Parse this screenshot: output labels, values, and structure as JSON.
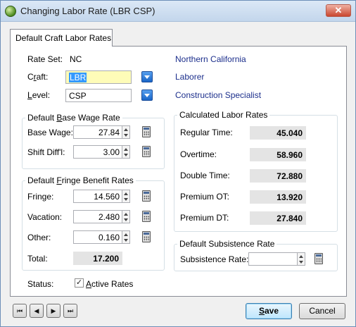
{
  "window": {
    "title": "Changing Labor Rate  (LBR CSP)",
    "close_glyph": "✕"
  },
  "tab": {
    "label": "Default Craft Labor Rates"
  },
  "rate_set": {
    "label": "Rate Set:",
    "value": "NC",
    "description": "Northern California"
  },
  "craft": {
    "label_pre": "C",
    "label_ul": "r",
    "label_post": "aft:",
    "value": "LBR",
    "description": "Laborer"
  },
  "level": {
    "label_pre": "",
    "label_ul": "L",
    "label_post": "evel:",
    "value": "CSP",
    "description": "Construction Specialist"
  },
  "base_wage": {
    "title_pre": "Default ",
    "title_ul": "B",
    "title_post": "ase Wage Rate",
    "base_wage_label": "Base Wage:",
    "base_wage_value": "27.84",
    "shift_diff_label": "Shift Diff'l:",
    "shift_diff_value": "3.00"
  },
  "fringe": {
    "title_pre": "Default ",
    "title_ul": "F",
    "title_post": "ringe Benefit Rates",
    "fringe_label": "Fringe:",
    "fringe_value": "14.560",
    "vacation_label": "Vacation:",
    "vacation_value": "2.480",
    "other_label": "Other:",
    "other_value": "0.160",
    "total_label": "Total:",
    "total_value": "17.200"
  },
  "calculated": {
    "title": "Calculated Labor Rates",
    "regular_label": "Regular Time:",
    "regular_value": "45.040",
    "overtime_label": "Overtime:",
    "overtime_value": "58.960",
    "double_label": "Double Time:",
    "double_value": "72.880",
    "premium_ot_label": "Premium OT:",
    "premium_ot_value": "13.920",
    "premium_dt_label": "Premium DT:",
    "premium_dt_value": "27.840"
  },
  "subsistence": {
    "title": "Default Subsistence Rate",
    "label": "Subsistence Rate:",
    "value": ""
  },
  "status": {
    "label": "Status:",
    "checkbox_checked": true,
    "check_glyph": "✓",
    "checkbox_label_ul": "A",
    "checkbox_label_post": "ctive Rates"
  },
  "nav": {
    "first": "⏮",
    "prev": "◀",
    "next": "▶",
    "last": "⏭"
  },
  "buttons": {
    "save_ul": "S",
    "save_post": "ave",
    "cancel": "Cancel"
  },
  "colors": {
    "link_blue": "#1c2f8c",
    "highlight_field": "#fefcb8",
    "selection": "#3399ff"
  }
}
